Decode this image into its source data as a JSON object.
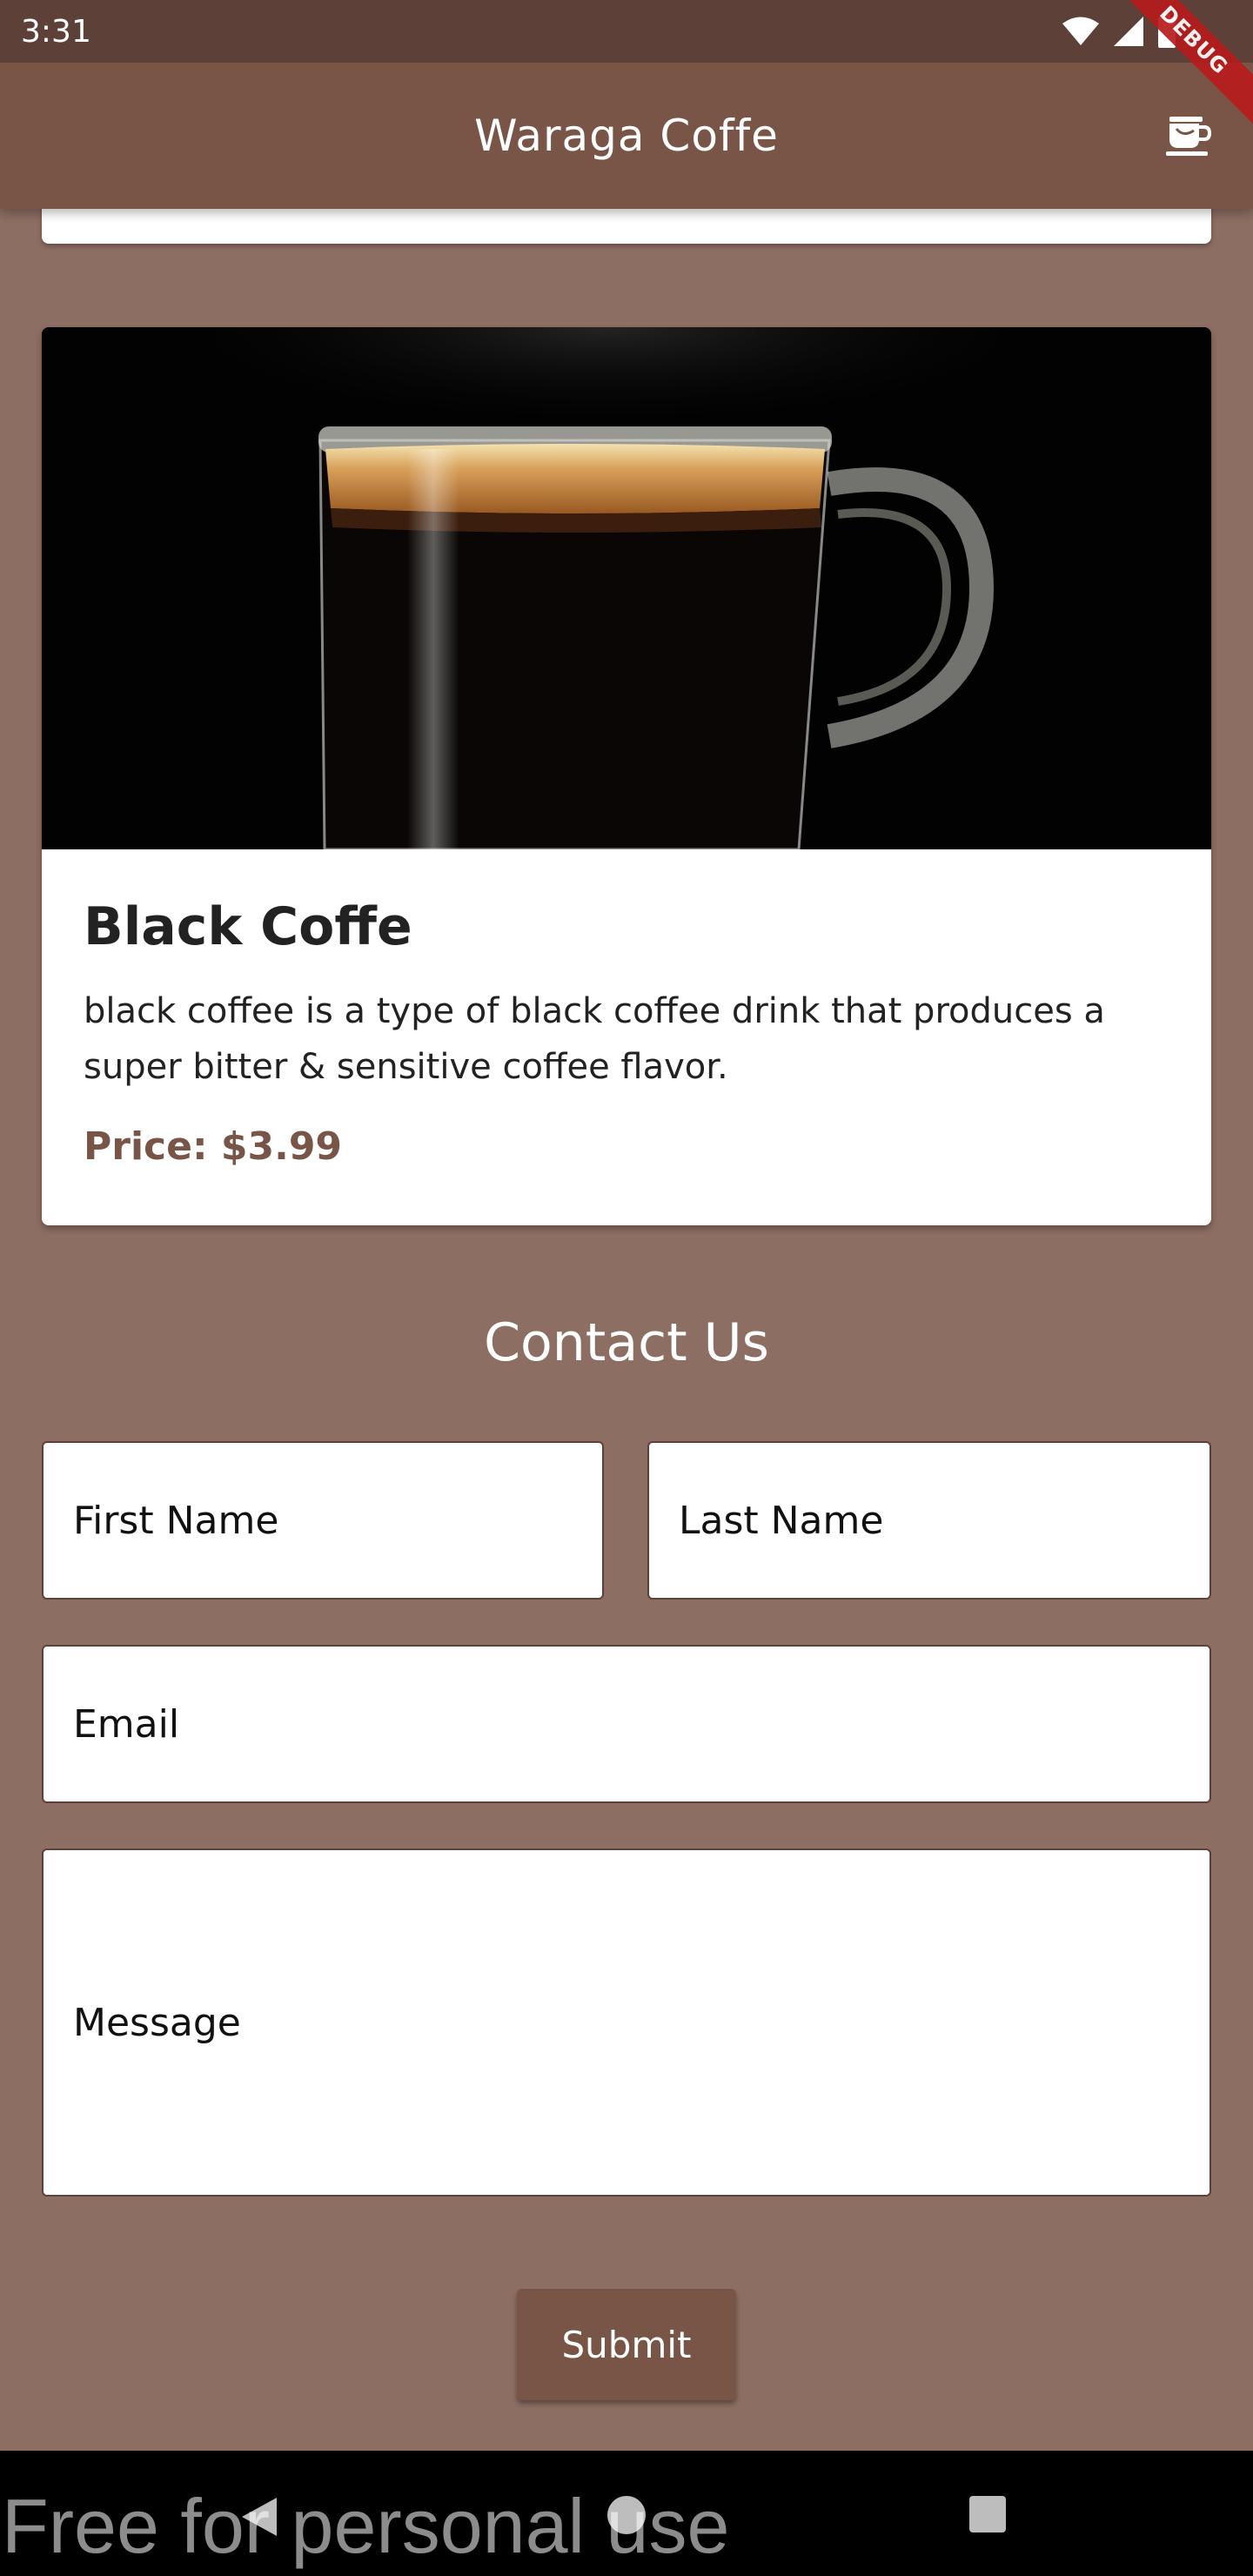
{
  "status_bar": {
    "time": "3:31"
  },
  "debug_banner": "DEBUG",
  "app_bar": {
    "title": "Waraga Coffe",
    "icon": "coffee-cup-icon"
  },
  "product": {
    "title": "Black Coffe",
    "description": "black coffee is a type of black coffee drink that produces a super bitter & sensitive coffee flavor.",
    "price": "Price: $3.99"
  },
  "contact": {
    "title": "Contact Us",
    "first_name_placeholder": "First Name",
    "last_name_placeholder": "Last Name",
    "email_placeholder": "Email",
    "message_placeholder": "Message",
    "submit_label": "Submit"
  },
  "nav_bar": {
    "back": "back-icon",
    "home": "home-icon",
    "recent": "recent-apps-icon"
  },
  "watermark": "Free for personal use",
  "colors": {
    "background": "#8D6E63",
    "app_bar": "#795548",
    "status_bar": "#5D4037",
    "price_text": "#795548"
  }
}
